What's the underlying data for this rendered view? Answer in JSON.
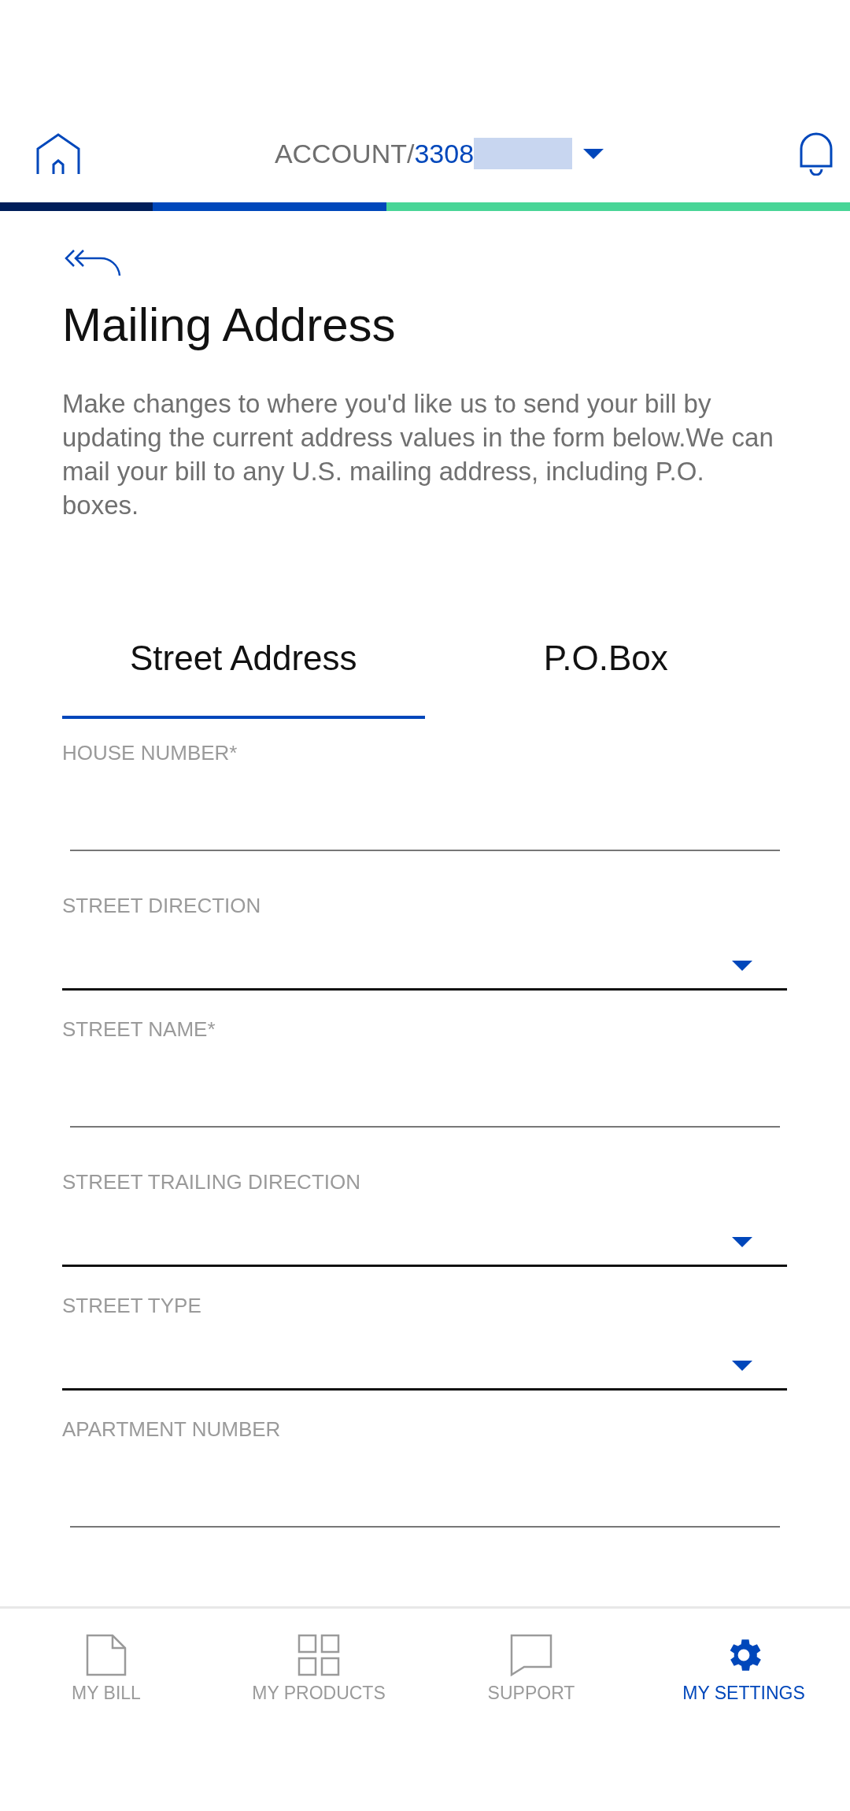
{
  "header": {
    "account_label": "ACCOUNT/",
    "account_number": "3308"
  },
  "page": {
    "title": "Mailing Address",
    "description": "Make changes to where you'd like us to send your bill by updating the current address values in the form below.We can mail your bill to any U.S. mailing address, including P.O. boxes."
  },
  "tabs": [
    {
      "label": "Street Address",
      "selected": true
    },
    {
      "label": "P.O.Box",
      "selected": false
    }
  ],
  "fields": [
    {
      "kind": "text",
      "label": "HOUSE NUMBER*"
    },
    {
      "kind": "select",
      "label": "STREET DIRECTION"
    },
    {
      "kind": "text",
      "label": "STREET NAME*"
    },
    {
      "kind": "select",
      "label": "STREET TRAILING DIRECTION"
    },
    {
      "kind": "select",
      "label": "STREET TYPE"
    },
    {
      "kind": "text",
      "label": "APARTMENT NUMBER"
    }
  ],
  "nav": [
    {
      "kind": "bill",
      "label": "MY BILL",
      "selected": false
    },
    {
      "kind": "products",
      "label": "MY PRODUCTS",
      "selected": false
    },
    {
      "kind": "support",
      "label": "SUPPORT",
      "selected": false
    },
    {
      "kind": "settings",
      "label": "MY SETTINGS",
      "selected": true
    }
  ]
}
